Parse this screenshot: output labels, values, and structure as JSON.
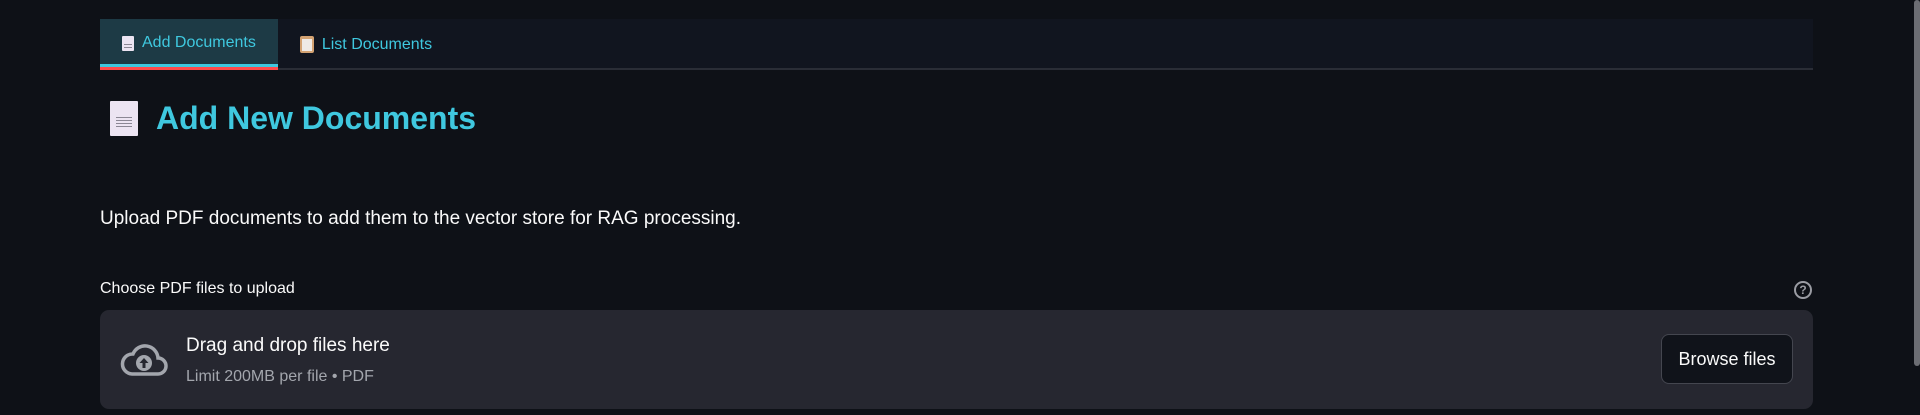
{
  "tabs": [
    {
      "label": "Add Documents",
      "icon": "page-icon",
      "active": true
    },
    {
      "label": "List Documents",
      "icon": "clipboard-icon",
      "active": false
    }
  ],
  "header": {
    "title": "Add New Documents",
    "icon": "page-icon"
  },
  "description": "Upload PDF documents to add them to the vector store for RAG processing.",
  "uploader": {
    "label": "Choose PDF files to upload",
    "help_icon": "?",
    "drop_title": "Drag and drop files here",
    "drop_hint": "Limit 200MB per file • PDF",
    "browse_label": "Browse files"
  },
  "colors": {
    "accent": "#3fc8df",
    "background": "#0e1117",
    "dropzone": "#262730",
    "tab_underline": "#ff4b4b"
  }
}
